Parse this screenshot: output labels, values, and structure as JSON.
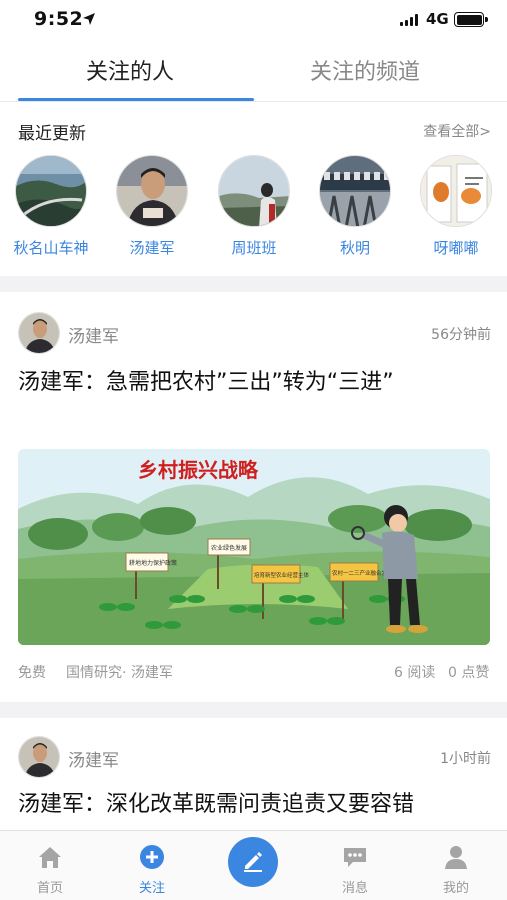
{
  "status_bar": {
    "time": "9:52",
    "network": "4G"
  },
  "tabs": [
    {
      "label": "关注的人",
      "active": true
    },
    {
      "label": "关注的频道",
      "active": false
    }
  ],
  "recent": {
    "title": "最近更新",
    "see_all": "查看全部>",
    "people": [
      {
        "name": "秋名山车神"
      },
      {
        "name": "汤建军"
      },
      {
        "name": "周班班"
      },
      {
        "name": "秋明"
      },
      {
        "name": "呀嘟嘟"
      }
    ]
  },
  "articles": [
    {
      "author": "汤建军",
      "time": "56分钟前",
      "title": "汤建军：急需把农村”三出”转为“三进”",
      "image": {
        "banner": "乡村振兴战略",
        "signs": [
          "耕地地力保护政策",
          "农业绿色发展",
          "培育新型农业经营主体",
          "农村一二三产业融合发展"
        ]
      },
      "price": "免费",
      "source": "国情研究· 汤建军",
      "reads": "6 阅读",
      "likes": "0 点赞"
    },
    {
      "author": "汤建军",
      "time": "1小时前",
      "title": "汤建军：深化改革既需问责追责又要容错"
    }
  ],
  "bottom_nav": [
    {
      "label": "首页",
      "icon": "home-icon",
      "active": false
    },
    {
      "label": "关注",
      "icon": "plus-circle-icon",
      "active": true
    },
    {
      "label": "",
      "icon": "compose-icon",
      "active": false
    },
    {
      "label": "消息",
      "icon": "message-icon",
      "active": false
    },
    {
      "label": "我的",
      "icon": "profile-icon",
      "active": false
    }
  ],
  "colors": {
    "accent": "#3b86e0",
    "muted": "#888888",
    "divider": "#f2f2f4"
  }
}
